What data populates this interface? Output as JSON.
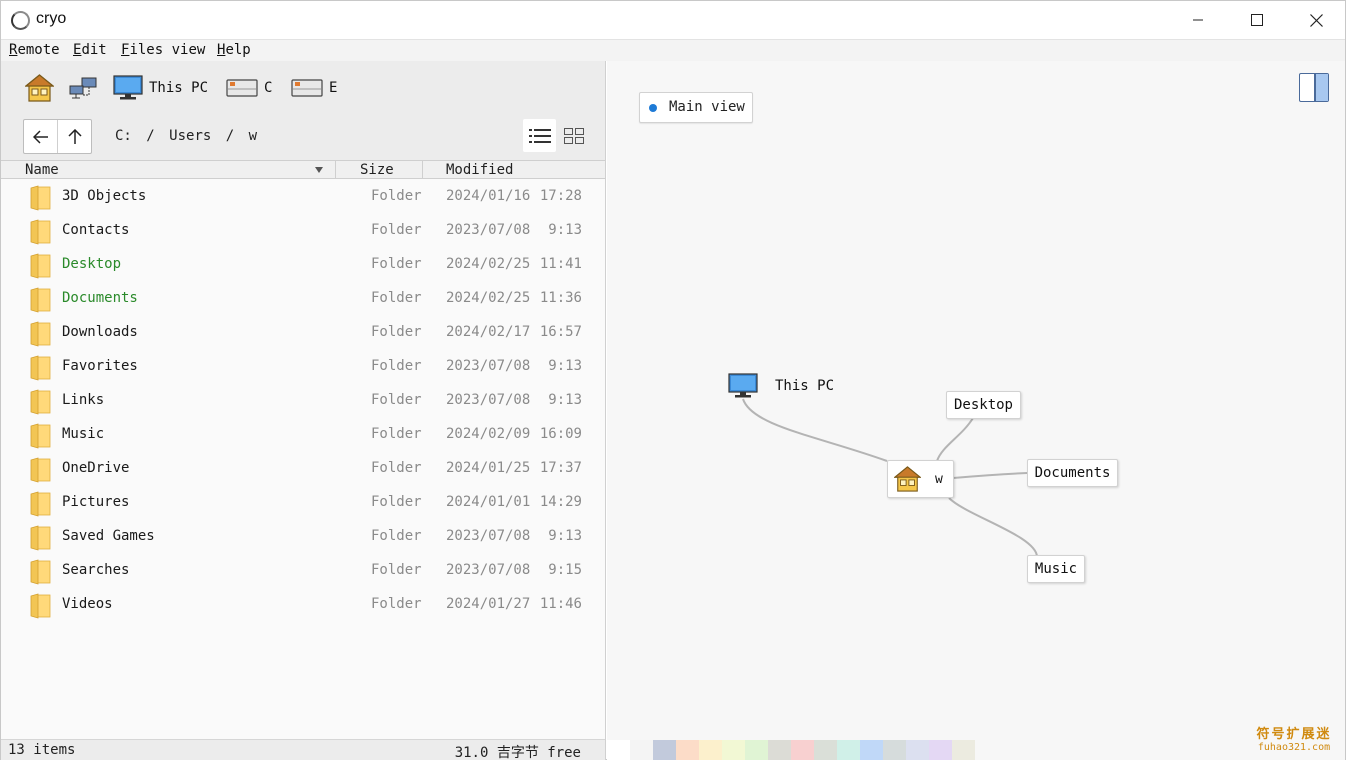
{
  "app": {
    "title": "cryo"
  },
  "menu": [
    {
      "accel": "R",
      "rest": "emote"
    },
    {
      "accel": "E",
      "rest": "dit"
    },
    {
      "accel": "F",
      "rest": "iles view"
    },
    {
      "accel": "H",
      "rest": "elp"
    }
  ],
  "locations": [
    {
      "label": "",
      "icon": "home-icon"
    },
    {
      "label": "",
      "icon": "network-icon"
    },
    {
      "label": "This PC",
      "icon": "computer-icon"
    },
    {
      "label": "C",
      "icon": "drive-icon"
    },
    {
      "label": "E",
      "icon": "drive-icon"
    }
  ],
  "breadcrumb": [
    "C:",
    "/",
    "Users",
    "/",
    "w"
  ],
  "columns": {
    "name": "Name",
    "size": "Size",
    "modified": "Modified"
  },
  "files": [
    {
      "name": "3D Objects",
      "size": "Folder",
      "date": "2024/01/16",
      "time": "17:28",
      "highlight": false
    },
    {
      "name": "Contacts",
      "size": "Folder",
      "date": "2023/07/08",
      "time": "9:13",
      "highlight": false
    },
    {
      "name": "Desktop",
      "size": "Folder",
      "date": "2024/02/25",
      "time": "11:41",
      "highlight": true
    },
    {
      "name": "Documents",
      "size": "Folder",
      "date": "2024/02/25",
      "time": "11:36",
      "highlight": true
    },
    {
      "name": "Downloads",
      "size": "Folder",
      "date": "2024/02/17",
      "time": "16:57",
      "highlight": false
    },
    {
      "name": "Favorites",
      "size": "Folder",
      "date": "2023/07/08",
      "time": "9:13",
      "highlight": false
    },
    {
      "name": "Links",
      "size": "Folder",
      "date": "2023/07/08",
      "time": "9:13",
      "highlight": false
    },
    {
      "name": "Music",
      "size": "Folder",
      "date": "2024/02/09",
      "time": "16:09",
      "highlight": false
    },
    {
      "name": "OneDrive",
      "size": "Folder",
      "date": "2024/01/25",
      "time": "17:37",
      "highlight": false
    },
    {
      "name": "Pictures",
      "size": "Folder",
      "date": "2024/01/01",
      "time": "14:29",
      "highlight": false
    },
    {
      "name": "Saved Games",
      "size": "Folder",
      "date": "2023/07/08",
      "time": "9:13",
      "highlight": false
    },
    {
      "name": "Searches",
      "size": "Folder",
      "date": "2023/07/08",
      "time": "9:15",
      "highlight": false
    },
    {
      "name": "Videos",
      "size": "Folder",
      "date": "2024/01/27",
      "time": "11:46",
      "highlight": false
    }
  ],
  "status": {
    "items": "13 items",
    "free": "31.0 吉字节 free"
  },
  "graph": {
    "view_label": "Main view",
    "pc_label": "This PC",
    "home_label": "w",
    "children": [
      "Desktop",
      "Documents",
      "Music"
    ]
  },
  "palette": [
    "#ffffff",
    "#f4f4f4",
    "#c2cadc",
    "#fcdcc8",
    "#fcf0cc",
    "#f2f8d4",
    "#e0f4d4",
    "#dcdcd6",
    "#f8d0d0",
    "#dadfd8",
    "#d0f0e8",
    "#c0d8f8",
    "#d6dcdc",
    "#dce0f0",
    "#e4d8f4",
    "#ecebe0"
  ],
  "watermark": {
    "line1": "符号扩展迷",
    "line2": "fuhao321.com"
  }
}
